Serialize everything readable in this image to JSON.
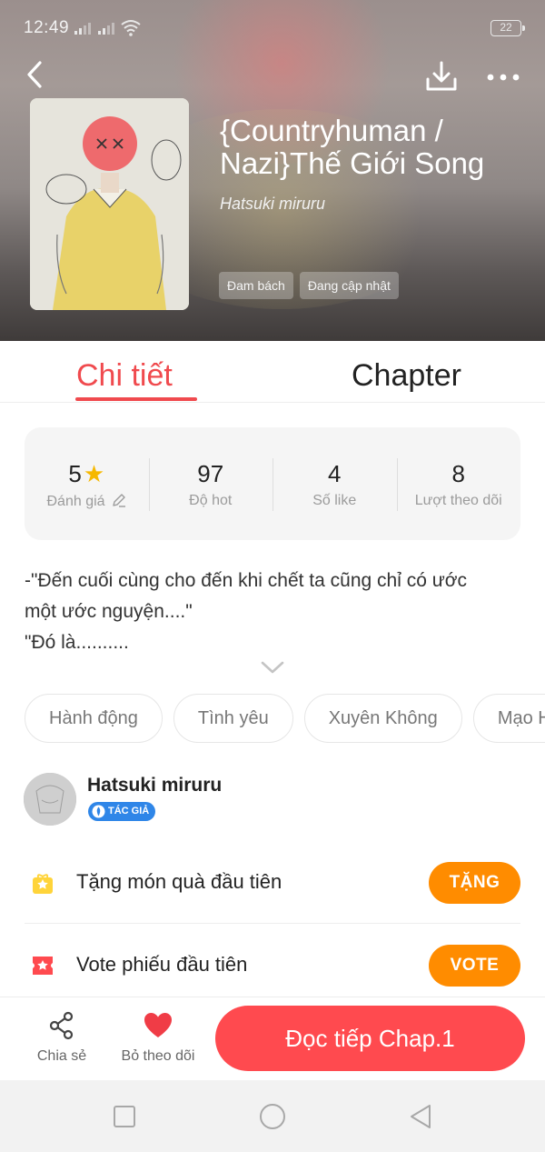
{
  "status": {
    "time": "12:49",
    "battery": "22"
  },
  "header": {
    "title_line1": "{Countryhuman /",
    "title_line2": "Nazi}Thế Giới Song",
    "author": "Hatsuki miruru",
    "tags": [
      "Đam bách",
      "Đang cập nhật"
    ]
  },
  "tabs": {
    "detail": "Chi tiết",
    "chapter": "Chapter"
  },
  "stats": [
    {
      "value": "5",
      "label": "Đánh giá"
    },
    {
      "value": "97",
      "label": "Độ hot"
    },
    {
      "value": "4",
      "label": "Số like"
    },
    {
      "value": "8",
      "label": "Lượt theo dõi"
    }
  ],
  "description": {
    "line1": "-\"Đến cuối cùng cho đến khi chết ta cũng chỉ có ước",
    "line2": "một ước nguyện....\"",
    "line3": "\"Đó là.........."
  },
  "genres": [
    "Hành động",
    "Tình yêu",
    "Xuyên Không",
    "Mạo Hiểm"
  ],
  "author_section": {
    "name": "Hatsuki miruru",
    "badge": "TÁC GIẢ"
  },
  "actions": {
    "gift": {
      "label": "Tặng món quà đầu tiên",
      "button": "TẶNG"
    },
    "vote": {
      "label": "Vote phiếu đầu tiên",
      "button": "VOTE"
    }
  },
  "bottom_bar": {
    "share": "Chia sẻ",
    "unfollow": "Bỏ theo dõi",
    "read": "Đọc tiếp Chap.1"
  },
  "colors": {
    "accent": "#f04a4e",
    "read_button": "#ff4a4f",
    "action_button": "#ff8c00",
    "badge": "#2f86e8",
    "star": "#f6b800"
  },
  "icons": [
    "back-arrow-icon",
    "download-icon",
    "more-icon",
    "star-icon",
    "edit-pencil-icon",
    "chevron-down-icon",
    "gift-icon",
    "ticket-icon",
    "share-icon",
    "heart-icon",
    "nav-recents-icon",
    "nav-home-icon",
    "nav-back-icon"
  ]
}
